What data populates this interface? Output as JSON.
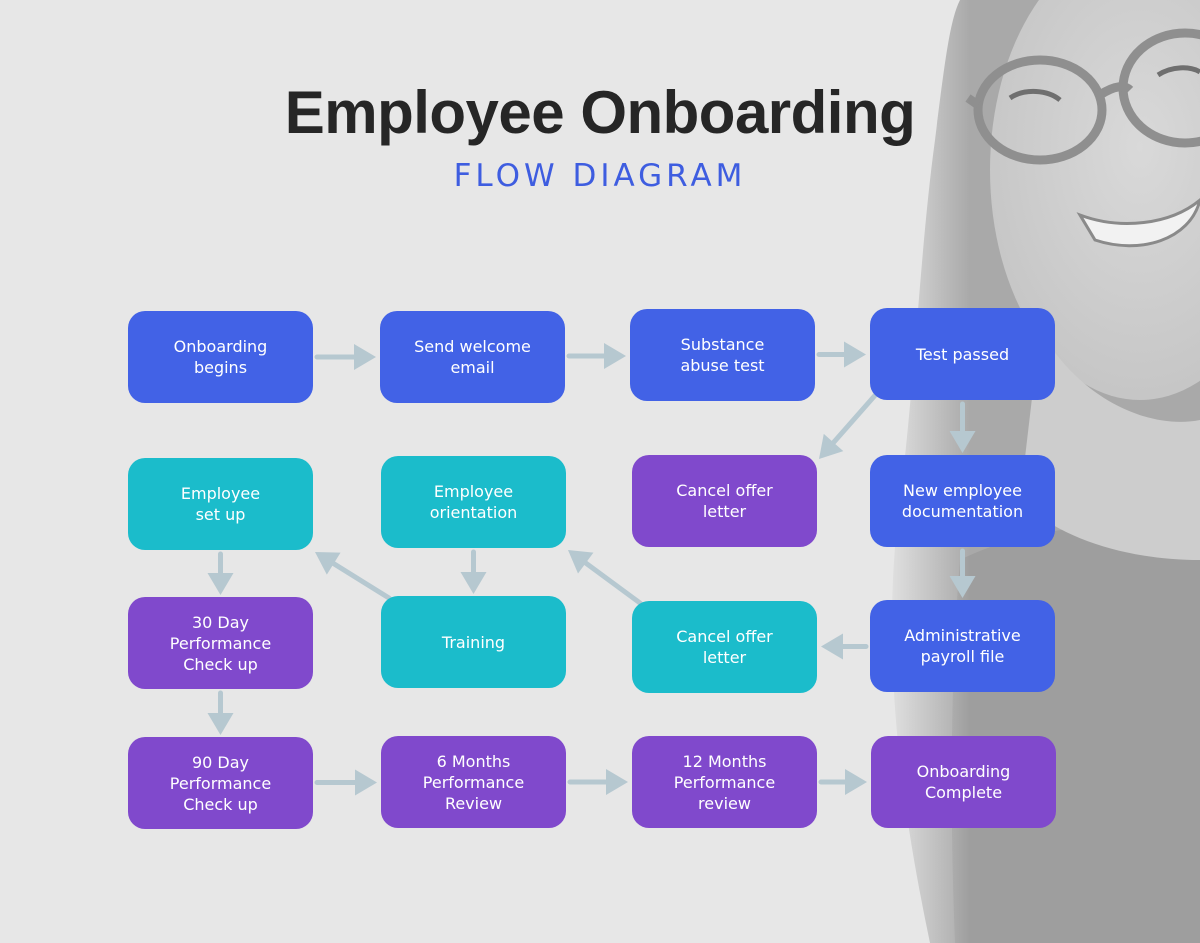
{
  "header": {
    "title": "Employee Onboarding",
    "subtitle": "FLOW DIAGRAM"
  },
  "colors": {
    "step_blue": "#4262e6",
    "step_teal": "#1bbccb",
    "step_purple": "#8049cc",
    "arrow": "#b6c8d0",
    "title": "#262626",
    "subtitle": "#3e5de0",
    "background": "#e7e7e7"
  },
  "background_image": "grayscale-photo-smiling-woman-with-glasses",
  "nodes": [
    {
      "id": "onboarding-begins",
      "label": "Onboarding\nbegins",
      "color": "blue"
    },
    {
      "id": "send-welcome-email",
      "label": "Send welcome\nemail",
      "color": "blue"
    },
    {
      "id": "substance-abuse-test",
      "label": "Substance\nabuse test",
      "color": "blue"
    },
    {
      "id": "test-passed",
      "label": "Test passed",
      "color": "blue"
    },
    {
      "id": "employee-set-up",
      "label": "Employee\nset up",
      "color": "teal"
    },
    {
      "id": "employee-orientation",
      "label": "Employee\norientation",
      "color": "teal"
    },
    {
      "id": "cancel-offer-letter-1",
      "label": "Cancel offer\nletter",
      "color": "purple"
    },
    {
      "id": "new-employee-documentation",
      "label": "New employee\ndocumentation",
      "color": "blue"
    },
    {
      "id": "30-day-check-up",
      "label": "30 Day\nPerformance\nCheck up",
      "color": "purple"
    },
    {
      "id": "training",
      "label": "Training",
      "color": "teal"
    },
    {
      "id": "cancel-offer-letter-2",
      "label": "Cancel offer\nletter",
      "color": "teal"
    },
    {
      "id": "administrative-payroll-file",
      "label": "Administrative\npayroll file",
      "color": "blue"
    },
    {
      "id": "90-day-check-up",
      "label": "90 Day\nPerformance\nCheck up",
      "color": "purple"
    },
    {
      "id": "6-months-review",
      "label": "6 Months\nPerformance\nReview",
      "color": "purple"
    },
    {
      "id": "12-months-review",
      "label": "12 Months\nPerformance\nreview",
      "color": "purple"
    },
    {
      "id": "onboarding-complete",
      "label": "Onboarding\nComplete",
      "color": "purple"
    }
  ],
  "edges": [
    {
      "from": "onboarding-begins",
      "to": "send-welcome-email"
    },
    {
      "from": "send-welcome-email",
      "to": "substance-abuse-test"
    },
    {
      "from": "substance-abuse-test",
      "to": "test-passed"
    },
    {
      "from": "test-passed",
      "to": "cancel-offer-letter-1"
    },
    {
      "from": "test-passed",
      "to": "new-employee-documentation"
    },
    {
      "from": "new-employee-documentation",
      "to": "administrative-payroll-file"
    },
    {
      "from": "administrative-payroll-file",
      "to": "cancel-offer-letter-2"
    },
    {
      "from": "cancel-offer-letter-2",
      "to": "employee-orientation"
    },
    {
      "from": "employee-orientation",
      "to": "training"
    },
    {
      "from": "training",
      "to": "employee-set-up"
    },
    {
      "from": "employee-set-up",
      "to": "30-day-check-up"
    },
    {
      "from": "30-day-check-up",
      "to": "90-day-check-up"
    },
    {
      "from": "90-day-check-up",
      "to": "6-months-review"
    },
    {
      "from": "6-months-review",
      "to": "12-months-review"
    },
    {
      "from": "12-months-review",
      "to": "onboarding-complete"
    }
  ]
}
